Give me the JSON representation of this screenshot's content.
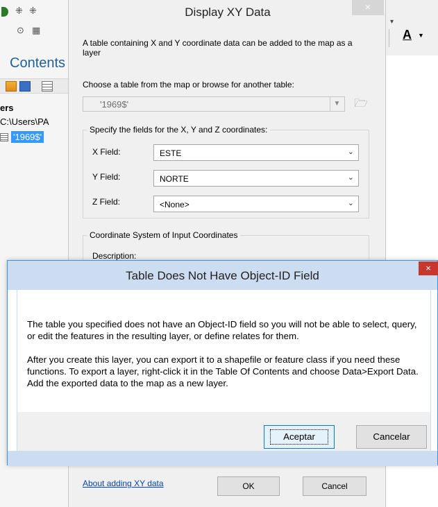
{
  "background": {
    "toc": {
      "title": "Contents",
      "layers_label": "ers",
      "path": "C:\\Users\\PA",
      "table_name": "'1969$'"
    }
  },
  "xy_dialog": {
    "title": "Display XY Data",
    "close_glyph": "×",
    "description": "A table containing X and Y coordinate data can be added to the map as a layer",
    "choose_label": "Choose a table from the map or browse for another table:",
    "table_value": "'1969$'",
    "fields_group_label": "Specify the fields for the X, Y and Z coordinates:",
    "x_label": "X Field:",
    "x_value": "ESTE",
    "y_label": "Y Field:",
    "y_value": "NORTE",
    "z_label": "Z Field:",
    "z_value": "<None>",
    "coord_group_label": "Coordinate System of Input Coordinates",
    "description_label": "Description:",
    "about_link": "About adding XY data",
    "ok_label": "OK",
    "cancel_label": "Cancel"
  },
  "message_dialog": {
    "title": "Table Does Not Have Object-ID Field",
    "close_glyph": "×",
    "paragraph1": "The table you specified does not have an Object-ID field so you will not be able to select, query, or edit the features in the resulting layer, or define relates for them.",
    "paragraph2": "After you create this layer, you can export it to a shapefile or feature class if you need these functions. To export a layer, right-click it in the Table Of Contents and choose Data>Export Data. Add the exported data to the map as a new layer.",
    "accept_label": "Aceptar",
    "cancel_label": "Cancelar"
  },
  "colors": {
    "modal_border": "#3c94e6",
    "modal_titlebar": "#ccdcf1",
    "close_red": "#c8372e",
    "selection": "#3399ff",
    "link": "#0645ad"
  }
}
